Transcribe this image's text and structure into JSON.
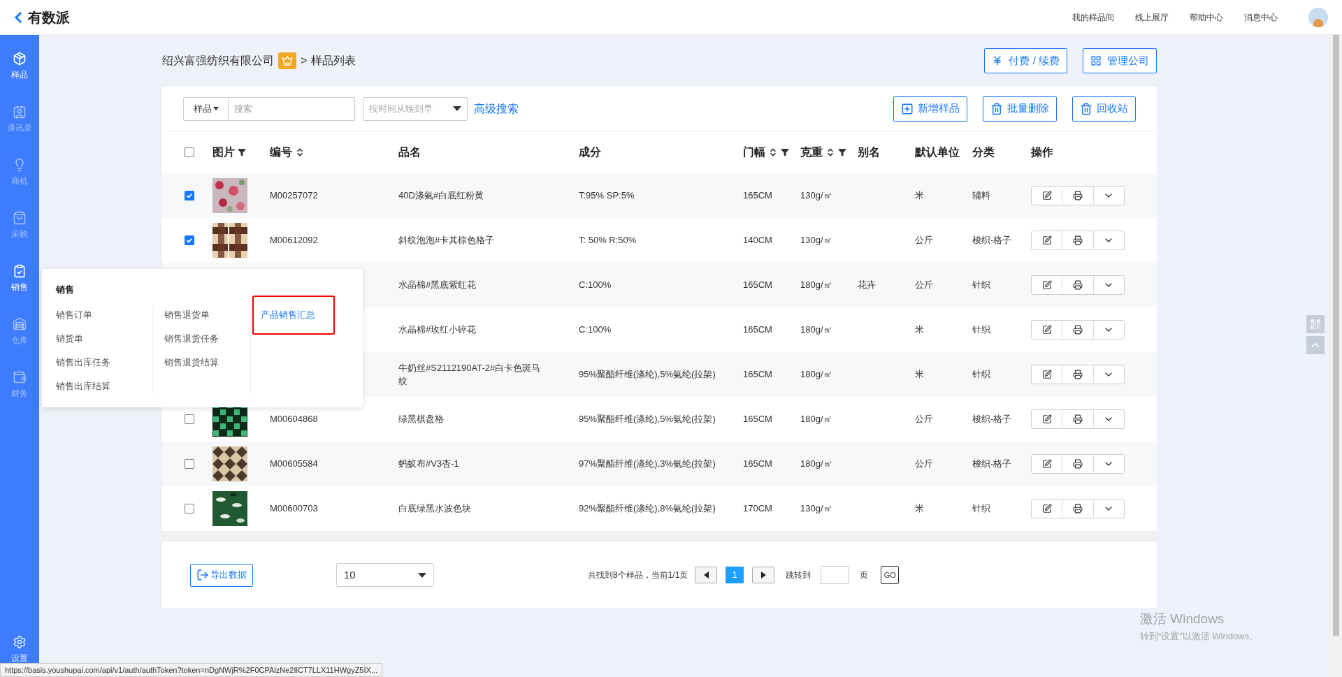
{
  "app": {
    "logo": "有数派"
  },
  "top_nav": [
    "我的样品间",
    "线上展厅",
    "帮助中心",
    "消息中心"
  ],
  "sidebar": {
    "items": [
      {
        "kind": "package",
        "label": "样品",
        "highlighted": true
      },
      {
        "kind": "contacts",
        "label": "通讯录",
        "highlighted": false
      },
      {
        "kind": "bulb",
        "label": "商机",
        "highlighted": false
      },
      {
        "kind": "bag",
        "label": "采购",
        "highlighted": false
      },
      {
        "kind": "clipboard",
        "label": "销售",
        "highlighted": true
      },
      {
        "kind": "home",
        "label": "仓库",
        "highlighted": false
      },
      {
        "kind": "money",
        "label": "财务",
        "highlighted": false
      }
    ],
    "settings": "设置"
  },
  "breadcrumb": {
    "company": "绍兴富强纺织有限公司",
    "separator": ">",
    "page": "样品列表"
  },
  "header_buttons": [
    {
      "kind": "yen",
      "label": "付费 / 续费"
    },
    {
      "kind": "grid",
      "label": "管理公司"
    }
  ],
  "toolbar": {
    "scope": "样品",
    "search_placeholder": "搜索",
    "sort_placeholder": "按时间从晚到早",
    "advanced": "高级搜索",
    "buttons": [
      {
        "kind": "add",
        "label": "新增样品"
      },
      {
        "kind": "trash",
        "label": "批量删除"
      },
      {
        "kind": "trash",
        "label": "回收站"
      }
    ]
  },
  "table": {
    "select_all": {
      "checked": false
    },
    "columns": [
      {
        "label": "图片",
        "kind": "filter"
      },
      {
        "label": "编号",
        "kind": "sort"
      },
      {
        "label": "品名",
        "kind": "plain"
      },
      {
        "label": "成分",
        "kind": "plain"
      },
      {
        "label": "门幅",
        "kind": "sort_filter"
      },
      {
        "label": "克重",
        "kind": "sort_filter"
      },
      {
        "label": "别名",
        "kind": "plain"
      },
      {
        "label": "默认单位",
        "kind": "plain"
      },
      {
        "label": "分类",
        "kind": "plain"
      },
      {
        "label": "操作",
        "kind": "plain"
      }
    ],
    "rows": [
      {
        "checked": true,
        "code": "M00257072",
        "name": "40D涤氨#白底红粉黄",
        "composition": "T:95% SP:5%",
        "width": "165CM",
        "weight": "130g/㎡",
        "unit": "米",
        "category": "辅料"
      },
      {
        "checked": true,
        "code": "M00612092",
        "name": "斜纹泡泡#卡其棕色格子",
        "composition": "T: 50% R:50%",
        "width": "140CM",
        "weight": "130g/㎡",
        "unit": "公斤",
        "category": "梭织-格子"
      },
      {
        "name": "水晶棉#黑底紫红花",
        "composition": "C:100%",
        "width": "165CM",
        "weight": "180g/㎡",
        "alias": "花卉",
        "unit": "公斤",
        "category": "针织"
      },
      {
        "name": "水晶棉#玫红小碎花",
        "composition": "C:100%",
        "width": "165CM",
        "weight": "180g/㎡",
        "unit": "米",
        "category": "针织"
      },
      {
        "name": "牛奶丝#S2112190AT-2#白卡色斑马纹",
        "composition": "95%聚酯纤维(涤纶),5%氨纶(拉架)",
        "width": "165CM",
        "weight": "180g/㎡",
        "unit": "米",
        "category": "针织"
      },
      {
        "checked": false,
        "code": "M00604868",
        "name": "绿黑棋盘格",
        "composition": "95%聚酯纤维(涤纶),5%氨纶(拉架)",
        "width": "165CM",
        "weight": "180g/㎡",
        "unit": "公斤",
        "category": "梭织-格子"
      },
      {
        "checked": false,
        "code": "M00605584",
        "name": "蚂蚁布#V3杏-1",
        "composition": "97%聚酯纤维(涤纶),3%氨纶(拉架)",
        "width": "165CM",
        "weight": "180g/㎡",
        "unit": "公斤",
        "category": "梭织-格子"
      },
      {
        "checked": false,
        "code": "M00600703",
        "name": "白底绿黑水波色块",
        "composition": "92%聚酯纤维(涤纶),8%氨纶(拉架)",
        "width": "170CM",
        "weight": "130g/㎡",
        "unit": "米",
        "category": "针织"
      }
    ]
  },
  "footer": {
    "export": "导出数据",
    "page_size": "10",
    "summary": "共找到8个样品，当前1/1页",
    "pages": [
      {
        "label": "1",
        "selected": true
      }
    ],
    "jump_label": "跳转到",
    "page_unit": "页",
    "go": "GO"
  },
  "popup_menu": {
    "title": "销售",
    "columns": [
      [
        {
          "label": "销售订单",
          "selected": false
        },
        {
          "label": "销货单",
          "selected": false
        },
        {
          "label": "销售出库任务",
          "selected": false
        },
        {
          "label": "销售出库结算",
          "selected": false
        }
      ],
      [
        {
          "label": "销售退货单",
          "selected": false
        },
        {
          "label": "销售退货任务",
          "selected": false
        },
        {
          "label": "销售退货结算",
          "selected": false
        }
      ],
      [
        {
          "label": "产品销售汇总",
          "selected": true
        }
      ]
    ]
  },
  "status_url": "https://basis.youshupai.com/api/v1/auth/authToken?token=nDgNWjR%2F0CPAlzNe2IlCT7LLX11HWgyZ5IX...",
  "windows_notice": {
    "title": "激活 Windows",
    "subtitle": "转到“设置”以激活 Windows。"
  }
}
